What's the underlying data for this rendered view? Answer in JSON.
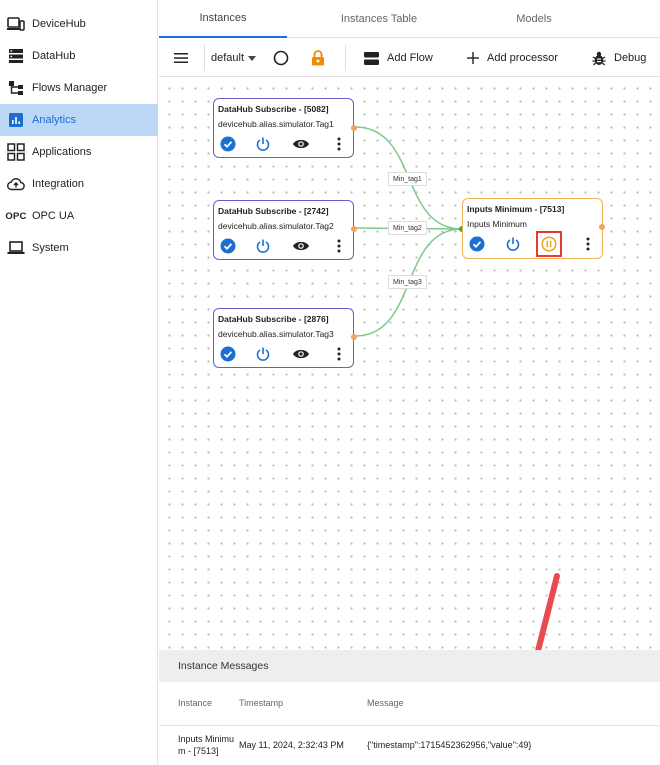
{
  "sidebar": {
    "items": [
      {
        "label": "DeviceHub",
        "icon": "devices-icon"
      },
      {
        "label": "DataHub",
        "icon": "storage-icon"
      },
      {
        "label": "Flows Manager",
        "icon": "flow-tree-icon"
      },
      {
        "label": "Analytics",
        "icon": "analytics-icon",
        "active": true
      },
      {
        "label": "Applications",
        "icon": "apps-grid-icon"
      },
      {
        "label": "Integration",
        "icon": "cloud-upload-icon"
      },
      {
        "label": "OPC UA",
        "icon": "opc-icon",
        "prefix": "OPC"
      },
      {
        "label": "System",
        "icon": "laptop-icon"
      }
    ]
  },
  "tabs": [
    {
      "label": "Instances",
      "active": true
    },
    {
      "label": "Instances Table"
    },
    {
      "label": "Models"
    }
  ],
  "toolbar": {
    "flow_select": "default",
    "add_flow": "Add Flow",
    "add_processor": "Add processor",
    "debug": "Debug"
  },
  "nodes": [
    {
      "title": "DataHub Subscribe - [5082]",
      "subtitle": "devicehub.alias.simulator.Tag1"
    },
    {
      "title": "DataHub Subscribe - [2742]",
      "subtitle": "devicehub.alias.simulator.Tag2"
    },
    {
      "title": "DataHub Subscribe - [2876]",
      "subtitle": "devicehub.alias.simulator.Tag3"
    },
    {
      "title": "Inputs Minimum - [7513]",
      "subtitle": "Inputs Minimum"
    }
  ],
  "edges": [
    "Min_tag1",
    "Min_tag2",
    "Min_tag3"
  ],
  "messages": {
    "title": "Instance Messages",
    "columns": [
      "Instance",
      "Timestamp",
      "Message"
    ],
    "rows": [
      {
        "instance_line1": "Inputs Minimu",
        "instance_line2": "m - [7513]",
        "timestamp": "May 11, 2024, 2:32:43 PM",
        "message": "{\"timestamp\":1715452362956,\"value\":49}"
      }
    ]
  },
  "colors": {
    "accent": "#1b6fd1",
    "active_bg": "#bdd7f7",
    "node_border": "#6b5fc7",
    "selected_border": "#f0b35a",
    "edge": "#7cc88a",
    "lock": "#f08c00",
    "arrow": "#e84a4f",
    "highlight": "#e53935"
  }
}
